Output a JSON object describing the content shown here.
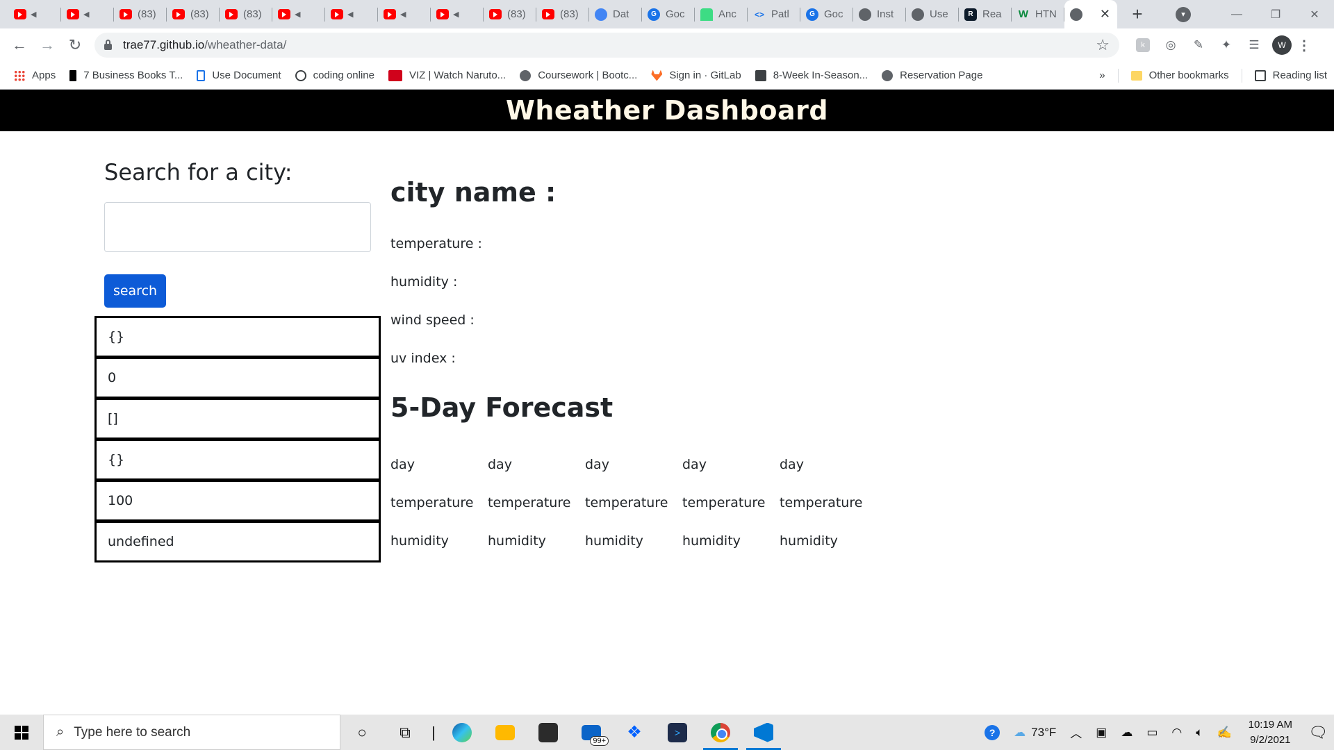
{
  "browser": {
    "tabs": [
      {
        "icon": "youtube",
        "title": "",
        "muted": true
      },
      {
        "icon": "youtube",
        "title": "",
        "muted": true
      },
      {
        "icon": "youtube",
        "title": "(83)",
        "muted": false
      },
      {
        "icon": "youtube",
        "title": "(83)",
        "muted": false
      },
      {
        "icon": "youtube",
        "title": "(83)",
        "muted": false
      },
      {
        "icon": "youtube",
        "title": "",
        "muted": true
      },
      {
        "icon": "youtube",
        "title": "",
        "muted": true
      },
      {
        "icon": "youtube",
        "title": "",
        "muted": true
      },
      {
        "icon": "youtube",
        "title": "",
        "muted": true
      },
      {
        "icon": "youtube",
        "title": "(83)",
        "muted": false
      },
      {
        "icon": "youtube",
        "title": "(83)",
        "muted": false
      },
      {
        "icon": "google-cloud",
        "title": "Dat",
        "muted": false
      },
      {
        "icon": "google",
        "title": "Goc",
        "muted": false
      },
      {
        "icon": "android",
        "title": "Anc",
        "muted": false
      },
      {
        "icon": "code",
        "title": "Patl",
        "muted": false
      },
      {
        "icon": "google",
        "title": "Goc",
        "muted": false
      },
      {
        "icon": "globe",
        "title": "Inst",
        "muted": false
      },
      {
        "icon": "globe",
        "title": "Use",
        "muted": false
      },
      {
        "icon": "react",
        "title": "Rea",
        "muted": false
      },
      {
        "icon": "w3",
        "title": "HTN",
        "muted": false
      }
    ],
    "active_tab": {
      "icon": "globe",
      "title": ""
    },
    "new_tab_label": "+",
    "window_controls": {
      "minimize": "—",
      "restore": "❐",
      "close": "✕"
    },
    "address": {
      "host": "trae77.github.io",
      "path": "/wheather-data/"
    },
    "profile_initial": "W",
    "bookmarks": [
      {
        "icon": "apps",
        "label": "Apps"
      },
      {
        "icon": "black-bar",
        "label": "7 Business Books T..."
      },
      {
        "icon": "doc",
        "label": "Use Document"
      },
      {
        "icon": "circle",
        "label": "coding online"
      },
      {
        "icon": "viz",
        "label": "VIZ | Watch Naruto..."
      },
      {
        "icon": "globe",
        "label": "Coursework | Bootc..."
      },
      {
        "icon": "gitlab",
        "label": "Sign in · GitLab"
      },
      {
        "icon": "sr",
        "label": "8-Week In-Season..."
      },
      {
        "icon": "globe",
        "label": "Reservation Page"
      }
    ],
    "bookmarks_more": "»",
    "other_bookmarks": "Other bookmarks",
    "reading_list": "Reading list"
  },
  "app": {
    "title": "Wheather Dashboard",
    "search_heading": "Search for a city:",
    "search_input_value": "",
    "search_button": "search",
    "history": [
      "{}",
      "0",
      "[]",
      "{}",
      "100",
      "undefined"
    ],
    "current": {
      "city_label": "city name :",
      "temperature_label": "temperature :",
      "humidity_label": "humidity :",
      "wind_label": "wind speed :",
      "uv_label": "uv index :"
    },
    "forecast_heading": "5-Day Forecast",
    "forecast": [
      {
        "day": "day",
        "temperature": "temperature",
        "humidity": "humidity"
      },
      {
        "day": "day",
        "temperature": "temperature",
        "humidity": "humidity"
      },
      {
        "day": "day",
        "temperature": "temperature",
        "humidity": "humidity"
      },
      {
        "day": "day",
        "temperature": "temperature",
        "humidity": "humidity"
      },
      {
        "day": "day",
        "temperature": "temperature",
        "humidity": "humidity"
      }
    ]
  },
  "taskbar": {
    "search_placeholder": "Type here to search",
    "mail_badge": "99+",
    "weather": "73°F",
    "time": "10:19 AM",
    "date": "9/2/2021"
  },
  "colors": {
    "banner_bg": "#000000",
    "banner_text": "#fff8e7",
    "button_bg": "#0d5bd7"
  }
}
